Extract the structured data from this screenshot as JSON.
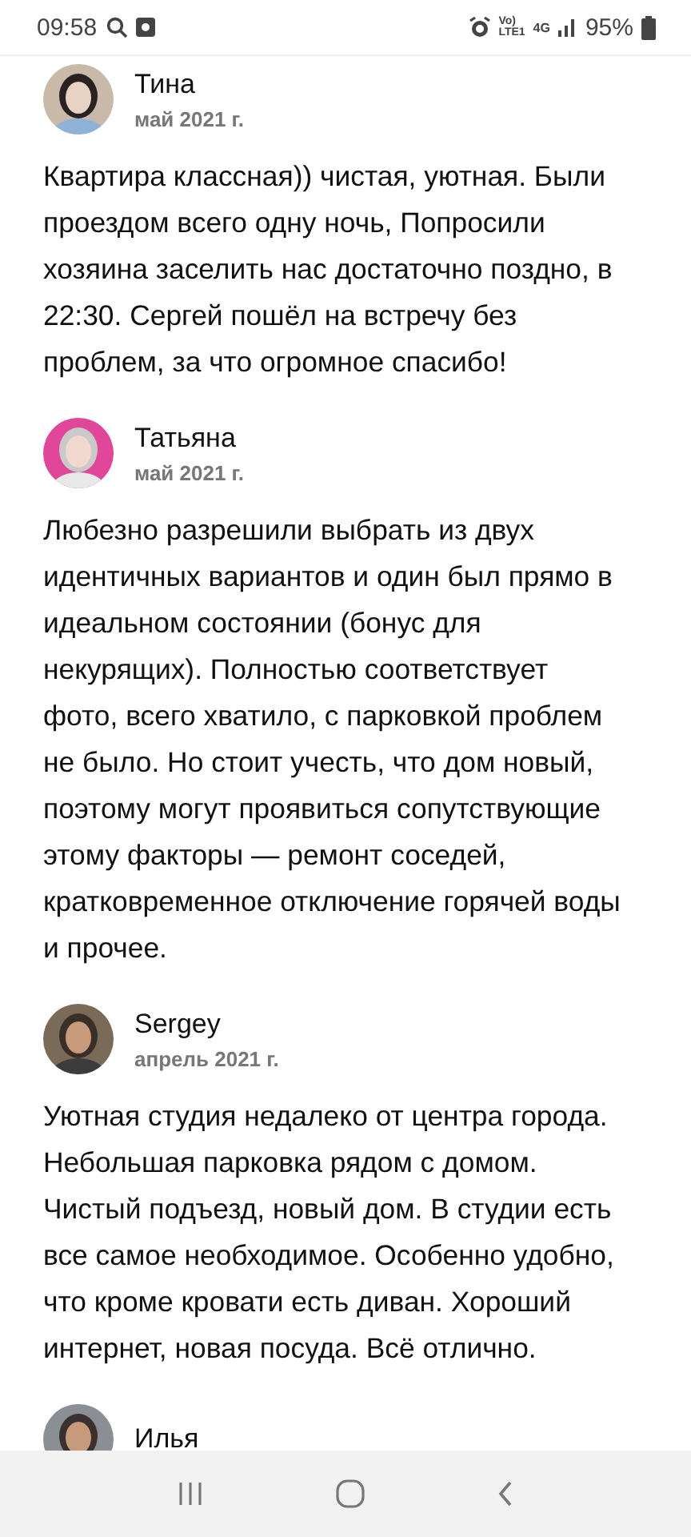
{
  "status_bar": {
    "time": "09:58",
    "volte": "Vo)",
    "lte": "LTE1",
    "network": "4G",
    "battery": "95%"
  },
  "reviews": [
    {
      "name": "Тина",
      "date": "май 2021 г.",
      "text": "Квартира классная)) чистая, уютная. Были проездом всего одну ночь, Попросили хозяина заселить нас достаточно поздно, в 22:30. Сергей пошёл на встречу без проблем, за что огромное спасибо!"
    },
    {
      "name": "Татьяна",
      "date": "май 2021 г.",
      "text": "Любезно разрешили выбрать из двух идентичных вариантов и один был прямо в идеальном состоянии (бонус для некурящих). Полностью соответствует фото, всего хватило, с парковкой проблем не было. Но стоит учесть, что дом новый, поэтому могут проявиться сопутствующие этому факторы — ремонт соседей, кратковременное отключение горячей воды и прочее."
    },
    {
      "name": "Sergey",
      "date": "апрель 2021 г.",
      "text": "Уютная студия недалеко от центра города. Небольшая парковка рядом с домом. Чистый подъезд, новый дом. В студии есть все самое необходимое. Особенно удобно, что кроме кровати есть диван. Хороший интернет, новая посуда. Всё отлично."
    },
    {
      "name": "Илья"
    }
  ]
}
